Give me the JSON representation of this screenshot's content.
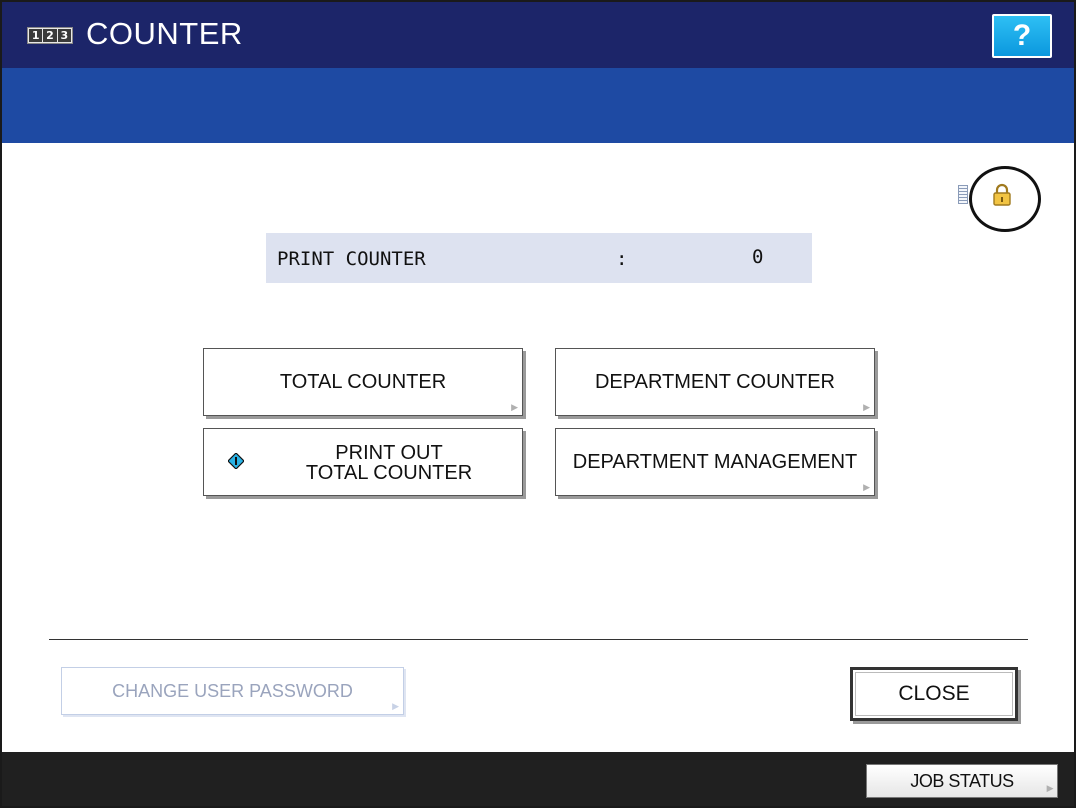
{
  "header": {
    "counter_digits": [
      "1",
      "2",
      "3"
    ],
    "title": "COUNTER",
    "help_label": "?"
  },
  "status": {
    "icons": [
      "document-icon",
      "lock-icon"
    ]
  },
  "print_counter": {
    "label": "PRINT COUNTER",
    "separator": ":",
    "value": "0"
  },
  "buttons": {
    "total_counter": "TOTAL COUNTER",
    "department_counter": "DEPARTMENT COUNTER",
    "print_out_line1": "PRINT OUT",
    "print_out_line2": "TOTAL COUNTER",
    "department_management": "DEPARTMENT MANAGEMENT",
    "change_user_password": "CHANGE USER PASSWORD",
    "close": "CLOSE"
  },
  "footer": {
    "job_status": "JOB STATUS"
  },
  "colors": {
    "title_bar": "#1c2569",
    "blue_band": "#1e4aa3",
    "help_button": "#0b98de",
    "counter_bar": "#dde2f0",
    "footer": "#202020"
  }
}
